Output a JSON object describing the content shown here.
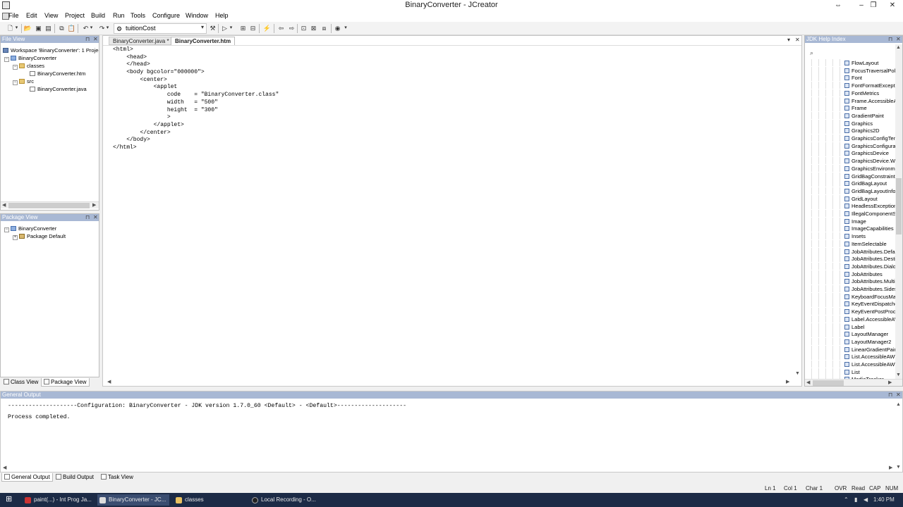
{
  "window": {
    "title": "BinaryConverter - JCreator",
    "restore_glyph": "⇔",
    "min_glyph": "–",
    "max_glyph": "❐",
    "close_glyph": "✕"
  },
  "menu": [
    "File",
    "Edit",
    "View",
    "Project",
    "Build",
    "Run",
    "Tools",
    "Configure",
    "Window",
    "Help"
  ],
  "toolbar": {
    "config_value": "tuitionCost"
  },
  "file_view": {
    "header": "File View",
    "items": [
      {
        "label": "Workspace 'BinaryConverter': 1 Project",
        "icon": "workspace-icon"
      },
      {
        "label": "BinaryConverter",
        "icon": "project-icon"
      },
      {
        "label": "classes",
        "icon": "folder-icon"
      },
      {
        "label": "BinaryConverter.htm",
        "icon": "file-icon"
      },
      {
        "label": "src",
        "icon": "folder-icon"
      },
      {
        "label": "BinaryConverter.java",
        "icon": "java-file-icon"
      }
    ]
  },
  "package_view": {
    "header": "Package View",
    "items": [
      {
        "label": "BinaryConverter",
        "icon": "project-icon"
      },
      {
        "label": "Package Default",
        "icon": "package-icon"
      }
    ]
  },
  "left_tabs": [
    "Class View",
    "Package View"
  ],
  "editor": {
    "tabs": [
      "BinaryConverter.java *",
      "BinaryConverter.htm"
    ],
    "active_tab": 1,
    "lines": [
      "<html>",
      "    <head>",
      "    </head>",
      "    <body bgcolor=\"000000\">",
      "        <center>",
      "            <applet",
      "                code    = \"BinaryConverter.class\"",
      "                width   = \"500\"",
      "                height  = \"300\"",
      "                >",
      "            </applet>",
      "        </center>",
      "    </body>",
      "</html>"
    ]
  },
  "jdk_help": {
    "header": "JDK Help Index",
    "items": [
      "FlowLayout",
      "FocusTraversalPolicy",
      "Font",
      "FontFormatException",
      "FontMetrics",
      "Frame.AccessibleAWTFrame",
      "Frame",
      "GradientPaint",
      "Graphics",
      "Graphics2D",
      "GraphicsConfigTemplate",
      "GraphicsConfiguration",
      "GraphicsDevice",
      "GraphicsDevice.WindowTranslucency",
      "GraphicsEnvironment",
      "GridBagConstraints",
      "GridBagLayout",
      "GridBagLayoutInfo",
      "GridLayout",
      "HeadlessException",
      "IllegalComponentStateException",
      "Image",
      "ImageCapabilities",
      "Insets",
      "ItemSelectable",
      "JobAttributes.DefaultSelectionType",
      "JobAttributes.DestinationType",
      "JobAttributes.DialogType",
      "JobAttributes",
      "JobAttributes.MultipleDocumentHandlingType",
      "JobAttributes.SidesType",
      "KeyboardFocusManager",
      "KeyEventDispatcher",
      "KeyEventPostProcessor",
      "Label.AccessibleAWTLabel",
      "Label",
      "LayoutManager",
      "LayoutManager2",
      "LinearGradientPaint",
      "List.AccessibleAWTList",
      "List.AccessibleAWTList.AccessibleAWTListChild",
      "List",
      "MediaTracker"
    ]
  },
  "output": {
    "header": "General Output",
    "line1": "--------------------Configuration: BinaryConverter - JDK version 1.7.0_60 <Default> - <Default>--------------------",
    "line2": "Process completed."
  },
  "bottom_tabs": [
    "General Output",
    "Build Output",
    "Task View"
  ],
  "status": {
    "ln": "Ln 1",
    "col": "Col 1",
    "char": "Char 1",
    "ovr": "OVR",
    "read": "Read",
    "cap": "CAP",
    "num": "NUM"
  },
  "taskbar": {
    "items": [
      "paint(...) - Int Prog Ja...",
      "BinaryConverter - JC...",
      "classes",
      "Local Recording - O..."
    ],
    "clock": "1:40 PM"
  },
  "colors": {
    "panel_header": "#a8b8d4",
    "taskbar": "#1c2b46"
  }
}
